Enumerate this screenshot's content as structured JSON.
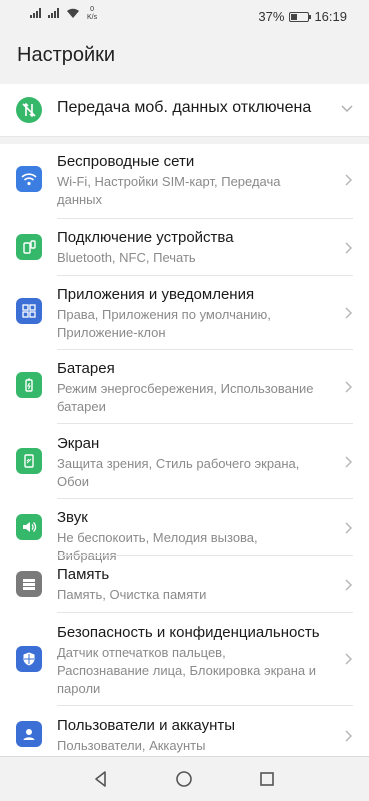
{
  "status_bar": {
    "net_speed_value": "0",
    "net_speed_unit": "K/s",
    "battery_percent": "37%",
    "battery_level": 0.37,
    "time": "16:19"
  },
  "page": {
    "title": "Настройки"
  },
  "mobile_data": {
    "label": "Передача моб. данных отключена",
    "icon": "mobile-data-off-icon",
    "icon_color": "#36b86a"
  },
  "items": [
    {
      "title": "Беспроводные сети",
      "subtitle": "Wi-Fi, Настройки SIM-карт, Передача данных",
      "icon": "wifi-icon",
      "color": "#3b7de0"
    },
    {
      "title": "Подключение устройства",
      "subtitle": "Bluetooth, NFC, Печать",
      "icon": "device-connection-icon",
      "color": "#36b86a"
    },
    {
      "title": "Приложения и уведомления",
      "subtitle": "Права, Приложения по умолчанию, Приложение-клон",
      "icon": "apps-icon",
      "color": "#3b6fd6"
    },
    {
      "title": "Батарея",
      "subtitle": "Режим энергосбережения, Использование батареи",
      "icon": "battery-icon",
      "color": "#36b86a"
    },
    {
      "title": "Экран",
      "subtitle": "Защита зрения, Стиль рабочего экрана, Обои",
      "icon": "display-icon",
      "color": "#36b86a"
    },
    {
      "title": "Звук",
      "subtitle": "Не беспокоить, Мелодия вызова, Вибрация",
      "icon": "sound-icon",
      "color": "#36b86a"
    },
    {
      "title": "Память",
      "subtitle": "Память, Очистка памяти",
      "icon": "storage-icon",
      "color": "#7a7a7a"
    },
    {
      "title": "Безопасность и конфиденциальность",
      "subtitle": "Датчик отпечатков пальцев, Распознавание лица, Блокировка экрана и пароли",
      "icon": "security-icon",
      "color": "#3b6fd6"
    },
    {
      "title": "Пользователи и аккаунты",
      "subtitle": "Пользователи, Аккаунты",
      "icon": "accounts-icon",
      "color": "#3b6fd6"
    }
  ],
  "nav_bar": {
    "back": "back-icon",
    "home": "home-icon",
    "recents": "recents-icon"
  }
}
